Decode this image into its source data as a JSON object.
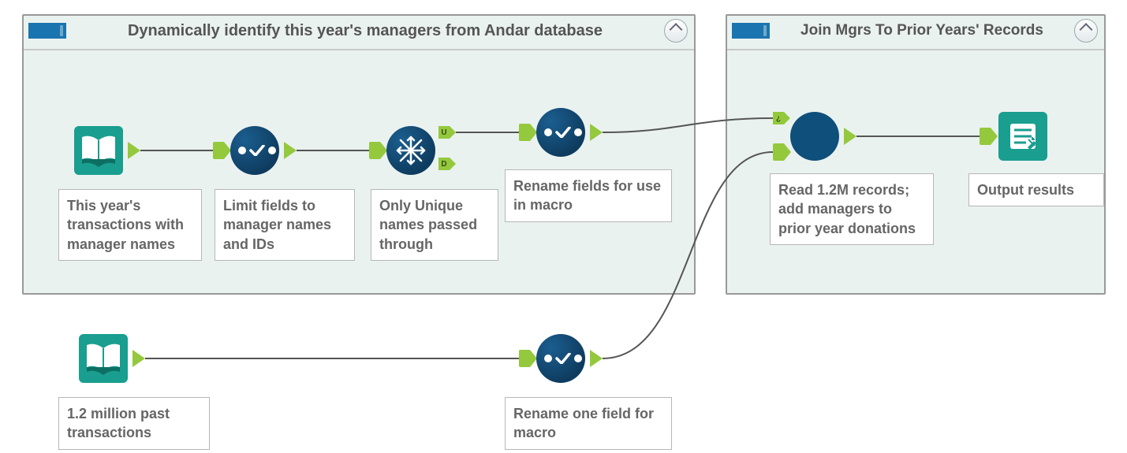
{
  "containers": {
    "left": {
      "title": "Dynamically identify this year's managers from Andar database"
    },
    "right": {
      "title": "Join Mgrs To Prior Years' Records"
    }
  },
  "nodes": {
    "thisyear_input": {
      "label": "This year's transactions with manager names"
    },
    "limit_fields": {
      "label": "Limit fields to manager names and IDs"
    },
    "unique": {
      "label": "Only Unique names passed through",
      "badge_u": "U",
      "badge_d": "D"
    },
    "rename_macro": {
      "label": "Rename fields for use in macro"
    },
    "past_input": {
      "label": "1.2 million past transactions"
    },
    "rename_one": {
      "label": "Rename one field for macro"
    },
    "join_macro": {
      "label": "Read 1.2M records; add managers to prior year donations",
      "in_badge": "¿"
    },
    "output": {
      "label": "Output results"
    }
  },
  "colors": {
    "container_bg": "#eaf2f0",
    "teal": "#199e8f",
    "navy": "#14557f",
    "anchor": "#94c93d"
  }
}
